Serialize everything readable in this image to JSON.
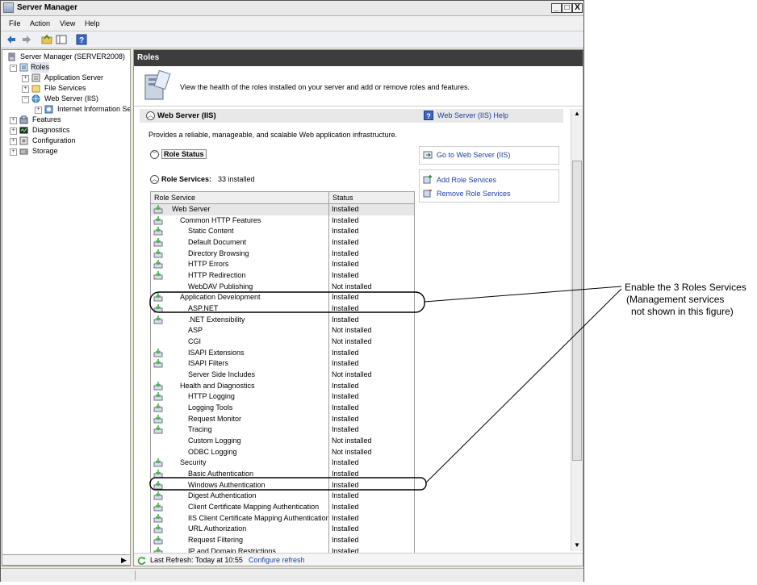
{
  "window": {
    "title": "Server Manager",
    "min_label": "_",
    "max_label": "□",
    "close_label": "X"
  },
  "menu": [
    "File",
    "Action",
    "View",
    "Help"
  ],
  "tree": {
    "root": "Server Manager (SERVER2008)",
    "roles": "Roles",
    "app_server": "Application Server",
    "file_services": "File Services",
    "web_server": "Web Server (IIS)",
    "iis": "Internet Information Se",
    "features": "Features",
    "diagnostics": "Diagnostics",
    "configuration": "Configuration",
    "storage": "Storage"
  },
  "main": {
    "header": "Roles",
    "intro": "View the health of the roles installed on your server and add or remove roles and features.",
    "section_title": "Web Server (IIS)",
    "help_link": "Web Server (IIS) Help",
    "description": "Provides a reliable, manageable, and scalable Web application infrastructure.",
    "role_status": "Role Status",
    "goto_link": "Go to Web Server (IIS)",
    "role_services_label": "Role Services:",
    "role_services_count": "33 installed",
    "add_link": "Add Role Services",
    "remove_link": "Remove Role Services",
    "col_service": "Role Service",
    "col_status": "Status",
    "rows": [
      {
        "name": "Web Server",
        "status": "Installed",
        "level": 0,
        "installed": true
      },
      {
        "name": "Common HTTP Features",
        "status": "Installed",
        "level": 1,
        "installed": true
      },
      {
        "name": "Static Content",
        "status": "Installed",
        "level": 2,
        "installed": true
      },
      {
        "name": "Default Document",
        "status": "Installed",
        "level": 2,
        "installed": true
      },
      {
        "name": "Directory Browsing",
        "status": "Installed",
        "level": 2,
        "installed": true
      },
      {
        "name": "HTTP Errors",
        "status": "Installed",
        "level": 2,
        "installed": true
      },
      {
        "name": "HTTP Redirection",
        "status": "Installed",
        "level": 2,
        "installed": true
      },
      {
        "name": "WebDAV Publishing",
        "status": "Not installed",
        "level": 2,
        "installed": false
      },
      {
        "name": "Application Development",
        "status": "Installed",
        "level": 1,
        "installed": true
      },
      {
        "name": "ASP.NET",
        "status": "Installed",
        "level": 2,
        "installed": true
      },
      {
        "name": ".NET Extensibility",
        "status": "Installed",
        "level": 2,
        "installed": true
      },
      {
        "name": "ASP",
        "status": "Not installed",
        "level": 2,
        "installed": false
      },
      {
        "name": "CGI",
        "status": "Not installed",
        "level": 2,
        "installed": false
      },
      {
        "name": "ISAPI Extensions",
        "status": "Installed",
        "level": 2,
        "installed": true
      },
      {
        "name": "ISAPI Filters",
        "status": "Installed",
        "level": 2,
        "installed": true
      },
      {
        "name": "Server Side Includes",
        "status": "Not installed",
        "level": 2,
        "installed": false
      },
      {
        "name": "Health and Diagnostics",
        "status": "Installed",
        "level": 1,
        "installed": true
      },
      {
        "name": "HTTP Logging",
        "status": "Installed",
        "level": 2,
        "installed": true
      },
      {
        "name": "Logging Tools",
        "status": "Installed",
        "level": 2,
        "installed": true
      },
      {
        "name": "Request Monitor",
        "status": "Installed",
        "level": 2,
        "installed": true
      },
      {
        "name": "Tracing",
        "status": "Installed",
        "level": 2,
        "installed": true
      },
      {
        "name": "Custom Logging",
        "status": "Not installed",
        "level": 2,
        "installed": false
      },
      {
        "name": "ODBC Logging",
        "status": "Not installed",
        "level": 2,
        "installed": false
      },
      {
        "name": "Security",
        "status": "Installed",
        "level": 1,
        "installed": true
      },
      {
        "name": "Basic Authentication",
        "status": "Installed",
        "level": 2,
        "installed": true
      },
      {
        "name": "Windows Authentication",
        "status": "Installed",
        "level": 2,
        "installed": true
      },
      {
        "name": "Digest Authentication",
        "status": "Installed",
        "level": 2,
        "installed": true
      },
      {
        "name": "Client Certificate Mapping Authentication",
        "status": "Installed",
        "level": 2,
        "installed": true
      },
      {
        "name": "IIS Client Certificate Mapping Authentication",
        "status": "Installed",
        "level": 2,
        "installed": true
      },
      {
        "name": "URL Authorization",
        "status": "Installed",
        "level": 2,
        "installed": true
      },
      {
        "name": "Request Filtering",
        "status": "Installed",
        "level": 2,
        "installed": true
      },
      {
        "name": "IP and Domain Restrictions",
        "status": "Installed",
        "level": 2,
        "installed": true
      }
    ],
    "last_refresh": "Last Refresh: Today at 10:55",
    "configure_refresh": "Configure refresh"
  },
  "annotation": {
    "line1": "Enable the 3 Roles Services",
    "line2": "(Management services",
    "line3": "not shown in this figure)"
  },
  "colors": {
    "link": "#1f3fa0",
    "header_bg": "#3d3d3d",
    "install_icon": "#4caf50"
  }
}
